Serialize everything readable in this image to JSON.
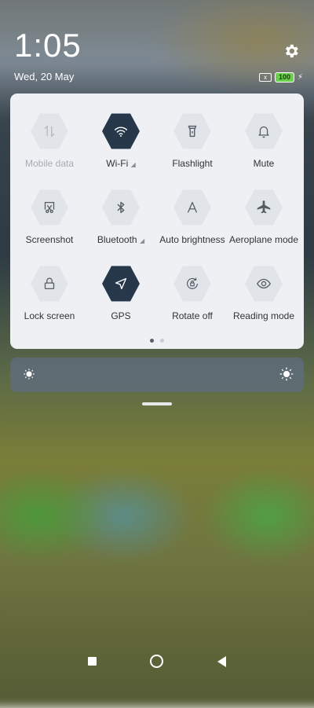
{
  "header": {
    "time": "1:05",
    "date": "Wed, 20 May"
  },
  "status": {
    "battery": "100",
    "sim_icon": "x"
  },
  "tiles": [
    {
      "label": "Mobile data",
      "state": "disabled"
    },
    {
      "label": "Wi-Fi",
      "state": "active",
      "has_menu": true
    },
    {
      "label": "Flashlight",
      "state": "off"
    },
    {
      "label": "Mute",
      "state": "off"
    },
    {
      "label": "Screenshot",
      "state": "off"
    },
    {
      "label": "Bluetooth",
      "state": "off",
      "has_menu": true
    },
    {
      "label": "Auto brightness",
      "state": "off"
    },
    {
      "label": "Aeroplane mode",
      "state": "off"
    },
    {
      "label": "Lock screen",
      "state": "off"
    },
    {
      "label": "GPS",
      "state": "active"
    },
    {
      "label": "Rotate off",
      "state": "off"
    },
    {
      "label": "Reading mode",
      "state": "off"
    }
  ],
  "colors": {
    "active": "#27384b",
    "inactive": "#e1e4e9",
    "panel": "#eef0f4",
    "battery": "#69d14a"
  },
  "pager": {
    "pages": 2,
    "current": 1
  }
}
